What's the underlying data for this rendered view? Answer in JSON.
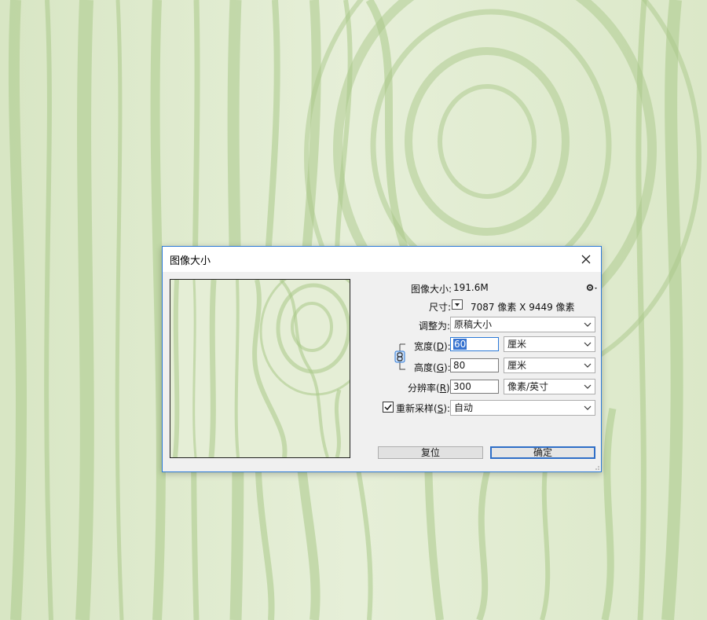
{
  "dialog": {
    "title": "图像大小",
    "image_size_label": "图像大小:",
    "image_size_value": "191.6M",
    "dimensions_label": "尺寸:",
    "dimensions_value": "7087 像素  X  9449 像素",
    "fit_to_label": "调整为:",
    "fit_to_value": "原稿大小",
    "width_label": "宽度(",
    "width_key": "D",
    "width_label_end": "):",
    "width_value": "60",
    "width_unit": "厘米",
    "height_label": "高度(",
    "height_key": "G",
    "height_label_end": "):",
    "height_value": "80",
    "height_unit": "厘米",
    "resolution_label": "分辨率(",
    "resolution_key": "R",
    "resolution_label_end": "):",
    "resolution_value": "300",
    "resolution_unit": "像素/英寸",
    "resample_label": "重新采样(",
    "resample_key": "S",
    "resample_label_end": "):",
    "resample_checked": true,
    "resample_value": "自动",
    "reset_button": "复位",
    "ok_button": "确定"
  },
  "icons": {
    "close": "close-icon",
    "gear": "gear-icon",
    "link": "constrain-link-icon",
    "dropdown": "chevron-down-icon",
    "checkmark": "checkmark-icon"
  },
  "colors": {
    "accent": "#2b79d7",
    "selection": "#3874d0",
    "wood_light": "#eef4e3",
    "wood_dark": "#9ec27a"
  }
}
